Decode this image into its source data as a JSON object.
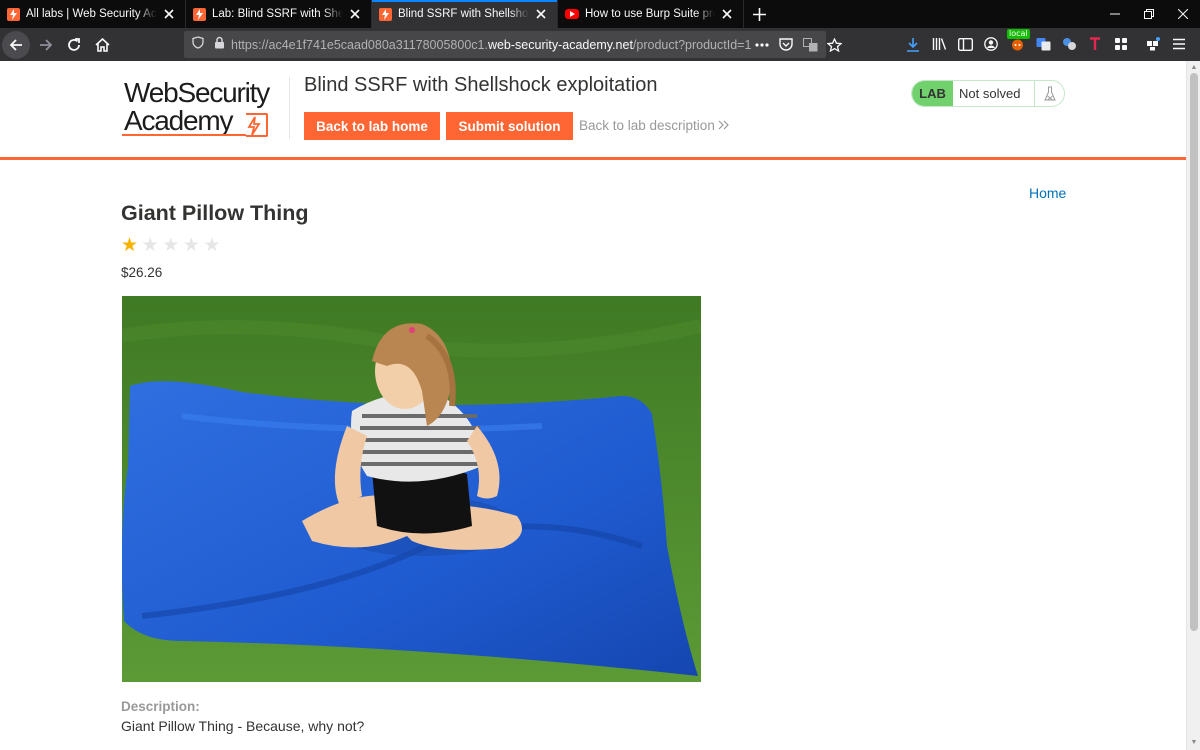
{
  "browser": {
    "tabs": [
      {
        "title": "All labs | Web Security Academy",
        "favicon": "web-security-academy-icon",
        "active": false
      },
      {
        "title": "Lab: Blind SSRF with Shellshock exploitation",
        "favicon": "web-security-academy-icon",
        "active": false
      },
      {
        "title": "Blind SSRF with Shellshock exploitation",
        "favicon": "web-security-academy-icon",
        "active": true
      },
      {
        "title": "How to use Burp Suite projects",
        "favicon": "youtube-icon",
        "active": false
      }
    ],
    "url": {
      "prefix": "https://ac4e1f741e5caad080a31178005800c1.",
      "host": "web-security-academy.net",
      "path": "/product?productId=1"
    },
    "local_badge": "local",
    "accent_color": "#0a84ff"
  },
  "header": {
    "logo_line1": "WebSecurity",
    "logo_line2": "Academy",
    "lab_title": "Blind SSRF with Shellshock exploitation",
    "back_to_lab_home": "Back to lab home",
    "submit_solution": "Submit solution",
    "back_to_description": "Back to lab description",
    "lab_badge": "LAB",
    "lab_status": "Not solved",
    "brand_color": "#ff6633",
    "status_color": "#70d16d"
  },
  "page": {
    "home_link": "Home",
    "product_name": "Giant Pillow Thing",
    "rating": {
      "value": 1,
      "max": 5
    },
    "price": "$26.26",
    "description_label": "Description:",
    "description_first_line": "Giant Pillow Thing - Because, why not?"
  }
}
